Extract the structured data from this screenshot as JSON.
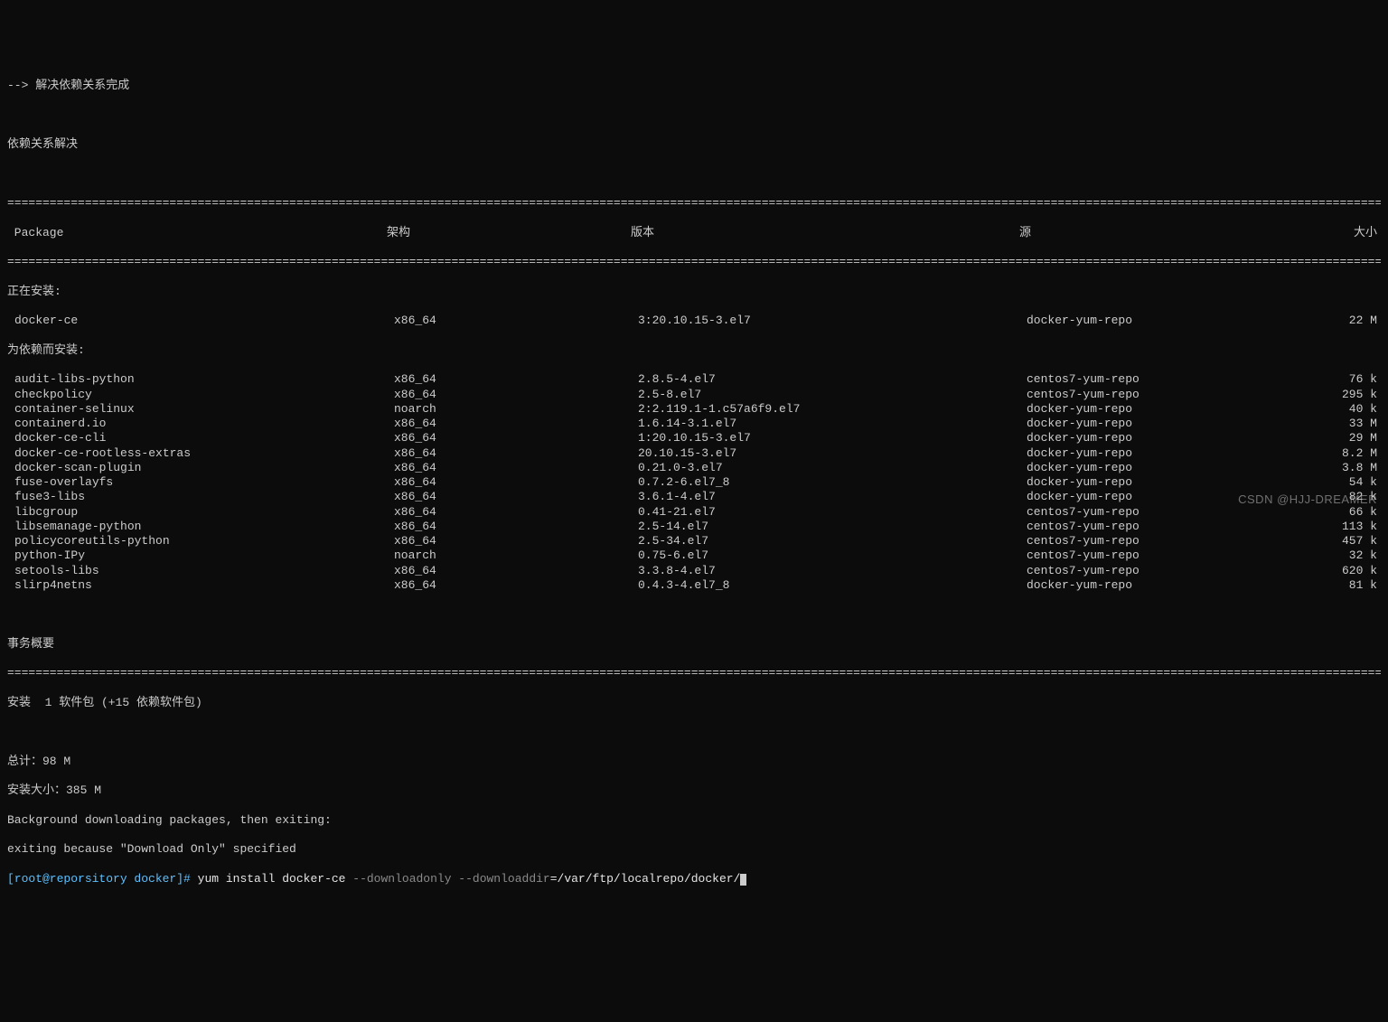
{
  "intro": {
    "line1": "--> 解决依赖关系完成",
    "line2": "依赖关系解决"
  },
  "headers": {
    "package": " Package",
    "arch": "架构",
    "version": "版本",
    "repo": "源",
    "size": "大小"
  },
  "sections": {
    "installing": "正在安装:",
    "deps": "为依赖而安装:"
  },
  "main_pkg": {
    "name": "docker-ce",
    "arch": "x86_64",
    "version": "3:20.10.15-3.el7",
    "repo": "docker-yum-repo",
    "size": "22 M"
  },
  "deps": [
    {
      "name": "audit-libs-python",
      "arch": "x86_64",
      "version": "2.8.5-4.el7",
      "repo": "centos7-yum-repo",
      "size": "76 k"
    },
    {
      "name": "checkpolicy",
      "arch": "x86_64",
      "version": "2.5-8.el7",
      "repo": "centos7-yum-repo",
      "size": "295 k"
    },
    {
      "name": "container-selinux",
      "arch": "noarch",
      "version": "2:2.119.1-1.c57a6f9.el7",
      "repo": "docker-yum-repo",
      "size": "40 k"
    },
    {
      "name": "containerd.io",
      "arch": "x86_64",
      "version": "1.6.14-3.1.el7",
      "repo": "docker-yum-repo",
      "size": "33 M"
    },
    {
      "name": "docker-ce-cli",
      "arch": "x86_64",
      "version": "1:20.10.15-3.el7",
      "repo": "docker-yum-repo",
      "size": "29 M"
    },
    {
      "name": "docker-ce-rootless-extras",
      "arch": "x86_64",
      "version": "20.10.15-3.el7",
      "repo": "docker-yum-repo",
      "size": "8.2 M"
    },
    {
      "name": "docker-scan-plugin",
      "arch": "x86_64",
      "version": "0.21.0-3.el7",
      "repo": "docker-yum-repo",
      "size": "3.8 M"
    },
    {
      "name": "fuse-overlayfs",
      "arch": "x86_64",
      "version": "0.7.2-6.el7_8",
      "repo": "docker-yum-repo",
      "size": "54 k"
    },
    {
      "name": "fuse3-libs",
      "arch": "x86_64",
      "version": "3.6.1-4.el7",
      "repo": "docker-yum-repo",
      "size": "82 k"
    },
    {
      "name": "libcgroup",
      "arch": "x86_64",
      "version": "0.41-21.el7",
      "repo": "centos7-yum-repo",
      "size": "66 k"
    },
    {
      "name": "libsemanage-python",
      "arch": "x86_64",
      "version": "2.5-14.el7",
      "repo": "centos7-yum-repo",
      "size": "113 k"
    },
    {
      "name": "policycoreutils-python",
      "arch": "x86_64",
      "version": "2.5-34.el7",
      "repo": "centos7-yum-repo",
      "size": "457 k"
    },
    {
      "name": "python-IPy",
      "arch": "noarch",
      "version": "0.75-6.el7",
      "repo": "centos7-yum-repo",
      "size": "32 k"
    },
    {
      "name": "setools-libs",
      "arch": "x86_64",
      "version": "3.3.8-4.el7",
      "repo": "centos7-yum-repo",
      "size": "620 k"
    },
    {
      "name": "slirp4netns",
      "arch": "x86_64",
      "version": "0.4.3-4.el7_8",
      "repo": "docker-yum-repo",
      "size": "81 k"
    }
  ],
  "summary": {
    "title": "事务概要",
    "install_line": "安装  1 软件包 (+15 依赖软件包)",
    "total": "总计：98 M",
    "install_size": "安装大小：385 M",
    "bg1": "Background downloading packages, then exiting:",
    "bg2": "exiting because \"Download Only\" specified"
  },
  "prompt": {
    "prefix": "[root@reporsitory docker]# ",
    "cmd_white": "yum install docker-ce ",
    "opt1": "--downloadonly --downloaddir",
    "eq_path": "=/var/ftp/localrepo/docker/"
  },
  "rule": "================================================================================================================================================================================================================================================================",
  "watermark": "CSDN @HJJ-DREAMER"
}
